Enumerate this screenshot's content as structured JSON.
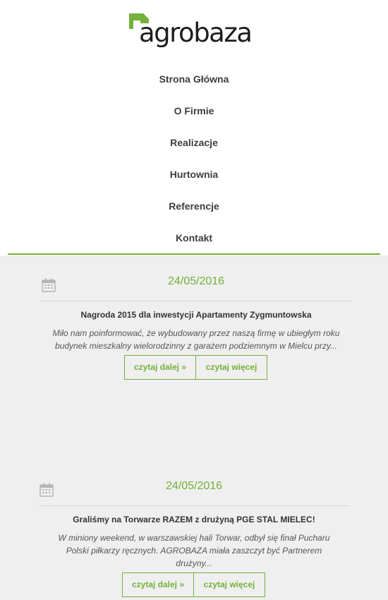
{
  "brand": {
    "logo_text": "agrobaza",
    "accent_color": "#74b03b"
  },
  "nav": {
    "items": [
      {
        "label": "Strona Główna"
      },
      {
        "label": "O Firmie"
      },
      {
        "label": "Realizacje"
      },
      {
        "label": "Hurtownia"
      },
      {
        "label": "Referencje"
      },
      {
        "label": "Kontakt"
      }
    ]
  },
  "posts": [
    {
      "icon": "calendar-icon",
      "date": "24/05/2016",
      "title": "Nagroda 2015 dla inwestycji Apartamenty Zygmuntowska",
      "excerpt": "Miło nam poinformować, że wybudowany przez naszą firmę w ubiegłym roku budynek mieszkalny wielorodzinny z garażem podziemnym w Mielcu przy...",
      "read_more_label": "czytaj dalej »",
      "read_more_alt_label": "czytaj więcej"
    },
    {
      "icon": "calendar-icon",
      "date": "24/05/2016",
      "title": "Graliśmy na Torwarze RAZEM z drużyną PGE STAL MIELEC!",
      "excerpt": "W miniony weekend, w warszawskiej hali Torwar, odbył się finał Pucharu Polski piłkarzy ręcznych. AGROBAZA miała zaszczyt być Partnerem drużyny...",
      "read_more_label": "czytaj dalej »",
      "read_more_alt_label": "czytaj więcej"
    }
  ]
}
